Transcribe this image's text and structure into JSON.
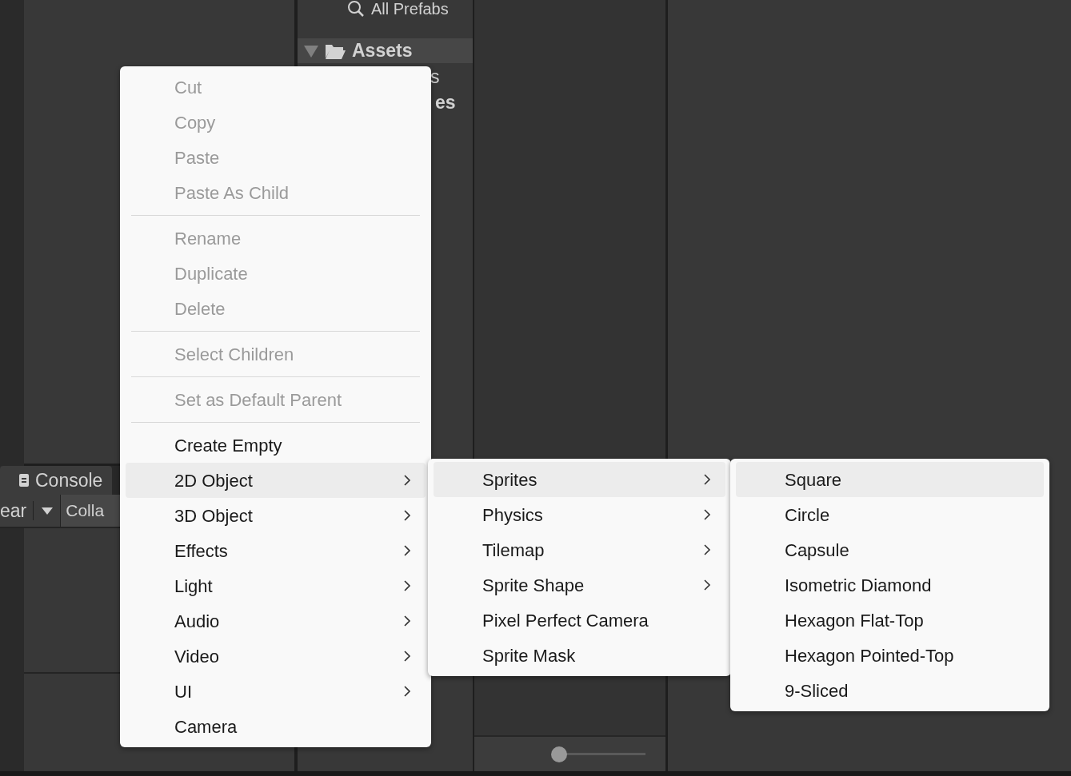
{
  "project_panel": {
    "search_item": "All Prefabs",
    "folder": {
      "label": "Assets",
      "expanded": true
    },
    "partial_items": [
      "s",
      "es"
    ]
  },
  "console_panel": {
    "tab": "Console",
    "clear_button": "ear",
    "collapse_button": "Colla"
  },
  "zoom_slider": {
    "level": 0
  },
  "menus": [
    {
      "items": [
        {
          "kind": "item",
          "label": "Cut",
          "disabled": true,
          "selected": false,
          "submenu": false
        },
        {
          "kind": "item",
          "label": "Copy",
          "disabled": true,
          "selected": false,
          "submenu": false
        },
        {
          "kind": "item",
          "label": "Paste",
          "disabled": true,
          "selected": false,
          "submenu": false
        },
        {
          "kind": "item",
          "label": "Paste As Child",
          "disabled": true,
          "selected": false,
          "submenu": false
        },
        {
          "kind": "separator"
        },
        {
          "kind": "item",
          "label": "Rename",
          "disabled": true,
          "selected": false,
          "submenu": false
        },
        {
          "kind": "item",
          "label": "Duplicate",
          "disabled": true,
          "selected": false,
          "submenu": false
        },
        {
          "kind": "item",
          "label": "Delete",
          "disabled": true,
          "selected": false,
          "submenu": false
        },
        {
          "kind": "separator"
        },
        {
          "kind": "item",
          "label": "Select Children",
          "disabled": true,
          "selected": false,
          "submenu": false
        },
        {
          "kind": "separator"
        },
        {
          "kind": "item",
          "label": "Set as Default Parent",
          "disabled": true,
          "selected": false,
          "submenu": false
        },
        {
          "kind": "separator"
        },
        {
          "kind": "item",
          "label": "Create Empty",
          "disabled": false,
          "selected": false,
          "submenu": false
        },
        {
          "kind": "item",
          "label": "2D Object",
          "disabled": false,
          "selected": true,
          "submenu": true
        },
        {
          "kind": "item",
          "label": "3D Object",
          "disabled": false,
          "selected": false,
          "submenu": true
        },
        {
          "kind": "item",
          "label": "Effects",
          "disabled": false,
          "selected": false,
          "submenu": true
        },
        {
          "kind": "item",
          "label": "Light",
          "disabled": false,
          "selected": false,
          "submenu": true
        },
        {
          "kind": "item",
          "label": "Audio",
          "disabled": false,
          "selected": false,
          "submenu": true
        },
        {
          "kind": "item",
          "label": "Video",
          "disabled": false,
          "selected": false,
          "submenu": true
        },
        {
          "kind": "item",
          "label": "UI",
          "disabled": false,
          "selected": false,
          "submenu": true
        },
        {
          "kind": "item",
          "label": "Camera",
          "disabled": false,
          "selected": false,
          "submenu": false
        }
      ]
    },
    {
      "items": [
        {
          "kind": "item",
          "label": "Sprites",
          "disabled": false,
          "selected": true,
          "submenu": true
        },
        {
          "kind": "item",
          "label": "Physics",
          "disabled": false,
          "selected": false,
          "submenu": true
        },
        {
          "kind": "item",
          "label": "Tilemap",
          "disabled": false,
          "selected": false,
          "submenu": true
        },
        {
          "kind": "item",
          "label": "Sprite Shape",
          "disabled": false,
          "selected": false,
          "submenu": true
        },
        {
          "kind": "item",
          "label": "Pixel Perfect Camera",
          "disabled": false,
          "selected": false,
          "submenu": false
        },
        {
          "kind": "item",
          "label": "Sprite Mask",
          "disabled": false,
          "selected": false,
          "submenu": false
        }
      ]
    },
    {
      "items": [
        {
          "kind": "item",
          "label": "Square",
          "disabled": false,
          "selected": true,
          "submenu": false
        },
        {
          "kind": "item",
          "label": "Circle",
          "disabled": false,
          "selected": false,
          "submenu": false
        },
        {
          "kind": "item",
          "label": "Capsule",
          "disabled": false,
          "selected": false,
          "submenu": false
        },
        {
          "kind": "item",
          "label": "Isometric Diamond",
          "disabled": false,
          "selected": false,
          "submenu": false
        },
        {
          "kind": "item",
          "label": "Hexagon Flat-Top",
          "disabled": false,
          "selected": false,
          "submenu": false
        },
        {
          "kind": "item",
          "label": "Hexagon Pointed-Top",
          "disabled": false,
          "selected": false,
          "submenu": false
        },
        {
          "kind": "item",
          "label": "9-Sliced",
          "disabled": false,
          "selected": false,
          "submenu": false
        }
      ]
    }
  ]
}
